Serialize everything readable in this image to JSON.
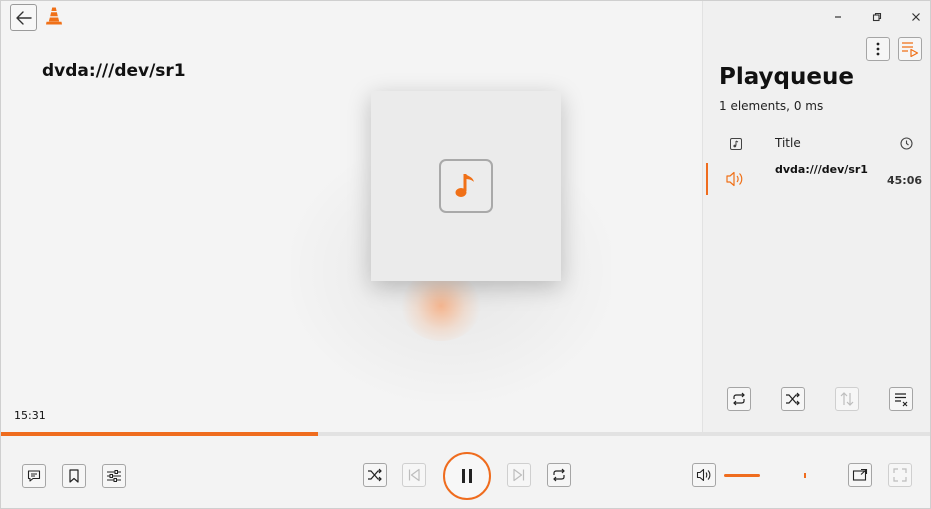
{
  "player": {
    "media_title": "dvda:///dev/sr1",
    "elapsed_time": "15:31",
    "progress_fraction": 0.34,
    "volume_fraction": 0.36,
    "volume_max_marker_fraction": 0.8
  },
  "playqueue": {
    "title": "Playqueue",
    "summary": "1 elements, 0 ms",
    "column_title": "Title",
    "items": [
      {
        "title": "dvda:///dev/sr1",
        "duration": "45:06",
        "playing": true
      }
    ]
  },
  "colors": {
    "accent": "#ef6c1e",
    "icon": "#333333",
    "disabled_icon": "#bdbdbd"
  },
  "icons": {
    "back": "arrow-left-icon",
    "logo": "vlc-cone-icon",
    "artwork": "music-note-icon",
    "minimize": "minimize-icon",
    "restore": "restore-icon",
    "close": "close-icon",
    "menu": "more-vertical-icon",
    "playqueue_toggle": "playlist-play-icon"
  }
}
